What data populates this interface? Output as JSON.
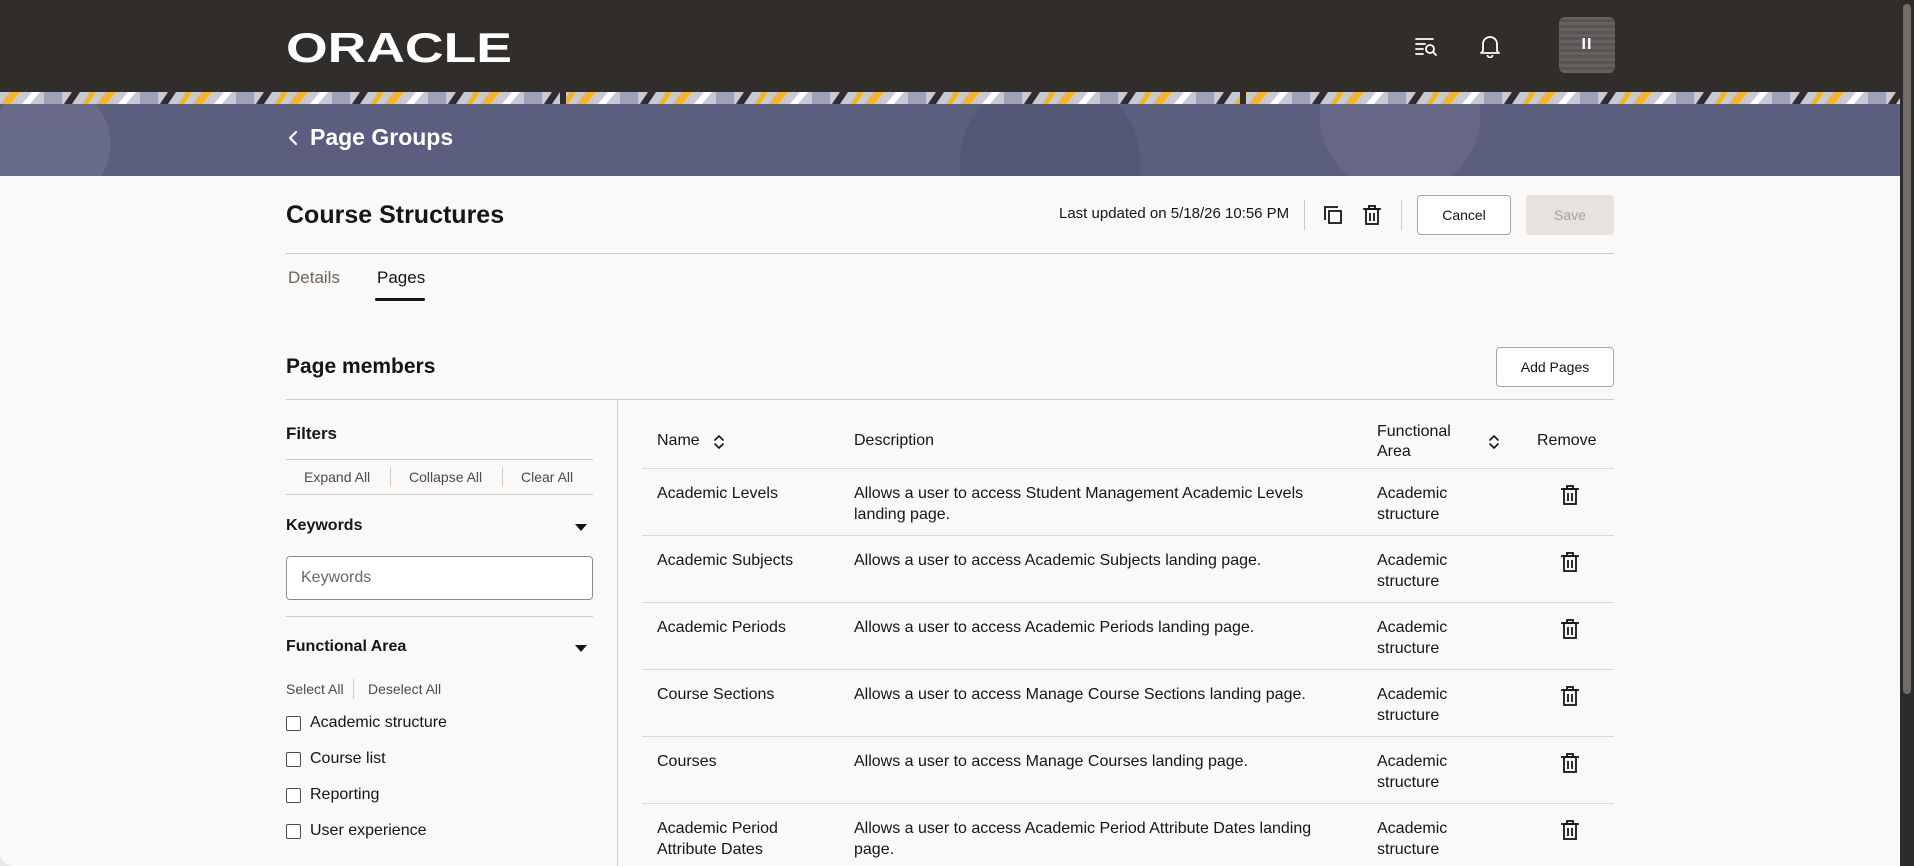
{
  "header": {
    "brand": "ORACLE",
    "avatar_initials": "II",
    "icons": [
      "search-list-icon",
      "bell-icon"
    ]
  },
  "banner": {
    "back_title": "Page Groups"
  },
  "page": {
    "title": "Course Structures",
    "last_updated": "Last updated on 5/18/26 10:56 PM",
    "cancel_label": "Cancel",
    "save_label": "Save"
  },
  "tabs": [
    {
      "label": "Details",
      "active": false
    },
    {
      "label": "Pages",
      "active": true
    }
  ],
  "members": {
    "title": "Page members",
    "add_label": "Add Pages"
  },
  "filters": {
    "title": "Filters",
    "expand_all": "Expand All",
    "collapse_all": "Collapse All",
    "clear_all": "Clear All",
    "keywords": {
      "title": "Keywords",
      "placeholder": "Keywords"
    },
    "functional_area": {
      "title": "Functional Area",
      "select_all": "Select All",
      "deselect_all": "Deselect All",
      "options": [
        "Academic structure",
        "Course list",
        "Reporting",
        "User experience"
      ]
    }
  },
  "table": {
    "columns": {
      "name": "Name",
      "description": "Description",
      "area": "Functional Area",
      "remove": "Remove"
    },
    "rows": [
      {
        "name": "Academic Levels",
        "description": "Allows a user to access Student Management Academic Levels landing page.",
        "area": "Academic structure"
      },
      {
        "name": "Academic Subjects",
        "description": "Allows a user to access Academic Subjects landing page.",
        "area": "Academic structure"
      },
      {
        "name": "Academic Periods",
        "description": "Allows a user to access Academic Periods landing page.",
        "area": "Academic structure"
      },
      {
        "name": "Course Sections",
        "description": "Allows a user to access Manage Course Sections landing page.",
        "area": "Academic structure"
      },
      {
        "name": "Courses",
        "description": "Allows a user to access Manage Courses landing page.",
        "area": "Academic structure"
      },
      {
        "name": "Academic Period Attribute Dates",
        "description": "Allows a user to access Academic Period Attribute Dates landing page.",
        "area": "Academic structure"
      }
    ]
  },
  "colors": {
    "header_bg": "#312d2a",
    "banner_bg": "#5c5e80",
    "page_bg": "#fbf9f8"
  }
}
